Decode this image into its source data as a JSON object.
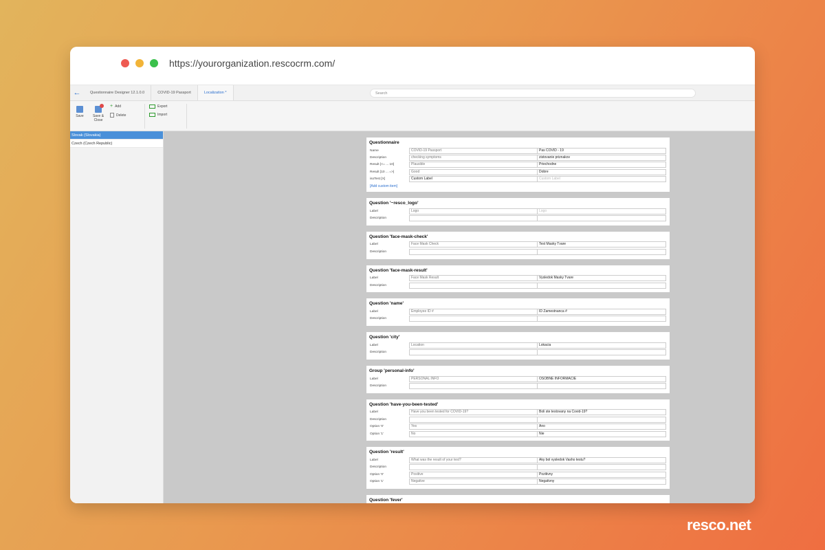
{
  "browser": {
    "url": "https://yourorganization.rescocrm.com/"
  },
  "tabs": [
    {
      "label": "Questionnaire Designer 12.1.0.0"
    },
    {
      "label": "COVID-19 Passport"
    },
    {
      "label": "Localization *"
    }
  ],
  "search": {
    "placeholder": "Search"
  },
  "ribbon": {
    "save": "Save",
    "save_close_1": "Save &",
    "save_close_2": "Close",
    "add": "Add",
    "delete": "Delete",
    "export": "Export",
    "import": "Import"
  },
  "languages": [
    {
      "label": "Slovak (Slovakia)",
      "selected": true
    },
    {
      "label": "Czech (Czech Republic)",
      "selected": false
    }
  ],
  "questionnaire": {
    "title": "Questionnaire",
    "rows": [
      {
        "label": "Name",
        "source": "COVID-19 Passport",
        "target": "Pas COVID - 19"
      },
      {
        "label": "Description",
        "source": "checking symptoms",
        "target": "zistovanie priznakov"
      },
      {
        "label": "Result [<= ... 10]",
        "source": "Plausible",
        "target": "Priechodne"
      },
      {
        "label": "Result [10 ... =>]",
        "source": "Good",
        "target": "Dobre"
      },
      {
        "label": "isoTest [X]",
        "source": "Custom Label",
        "target": "Custom Label"
      }
    ],
    "add_custom": "[Add custom item]"
  },
  "q_logo": {
    "title": "Question '~resco_logo'",
    "rows": [
      {
        "label": "Label",
        "source": "Logo",
        "target": "Logo"
      },
      {
        "label": "Description",
        "source": "",
        "target": ""
      }
    ]
  },
  "q_face_check": {
    "title": "Question 'face-mask-check'",
    "rows": [
      {
        "label": "Label",
        "source": "Face Mask Check",
        "target": "Test Masky Tvare"
      },
      {
        "label": "Description",
        "source": "",
        "target": ""
      }
    ]
  },
  "q_face_result": {
    "title": "Question 'face-mask-result'",
    "rows": [
      {
        "label": "Label",
        "source": "Face Mask Result",
        "target": "Vysledok Masky Tvare"
      },
      {
        "label": "Description",
        "source": "",
        "target": ""
      }
    ]
  },
  "q_name": {
    "title": "Question 'name'",
    "rows": [
      {
        "label": "Label",
        "source": "Employee ID #",
        "target": "ID Zamestnanca #"
      },
      {
        "label": "Description",
        "source": "",
        "target": ""
      }
    ]
  },
  "q_city": {
    "title": "Question 'city'",
    "rows": [
      {
        "label": "Label",
        "source": "Location",
        "target": "Lokacia"
      },
      {
        "label": "Description",
        "source": "",
        "target": ""
      }
    ]
  },
  "g_personal": {
    "title": "Group 'personal-info'",
    "rows": [
      {
        "label": "Label",
        "source": "PERSONAL INFO",
        "target": "OSOBNE INFORMACIE"
      },
      {
        "label": "Description",
        "source": "",
        "target": ""
      }
    ]
  },
  "q_tested": {
    "title": "Question 'have-you-been-tested'",
    "rows": [
      {
        "label": "Label",
        "source": "Have you been tested for COVID-19?",
        "target": "Boli ste testovany na Covid-19?"
      },
      {
        "label": "Description",
        "source": "",
        "target": ""
      },
      {
        "label": "Option '0'",
        "source": "Yes",
        "target": "Ano"
      },
      {
        "label": "Option '1'",
        "source": "No",
        "target": "Nie"
      }
    ]
  },
  "q_result": {
    "title": "Question 'result'",
    "rows": [
      {
        "label": "Label",
        "source": "What was the result of your test?",
        "target": "Aky bol vysledok Vasho testu?"
      },
      {
        "label": "Description",
        "source": "",
        "target": ""
      },
      {
        "label": "Option '0'",
        "source": "Positive",
        "target": "Pozitivny"
      },
      {
        "label": "Option '1'",
        "source": "Negative",
        "target": "Negativny"
      }
    ]
  },
  "q_fever": {
    "title": "Question 'fever'"
  },
  "brand": {
    "logo_text": "resco.net"
  }
}
